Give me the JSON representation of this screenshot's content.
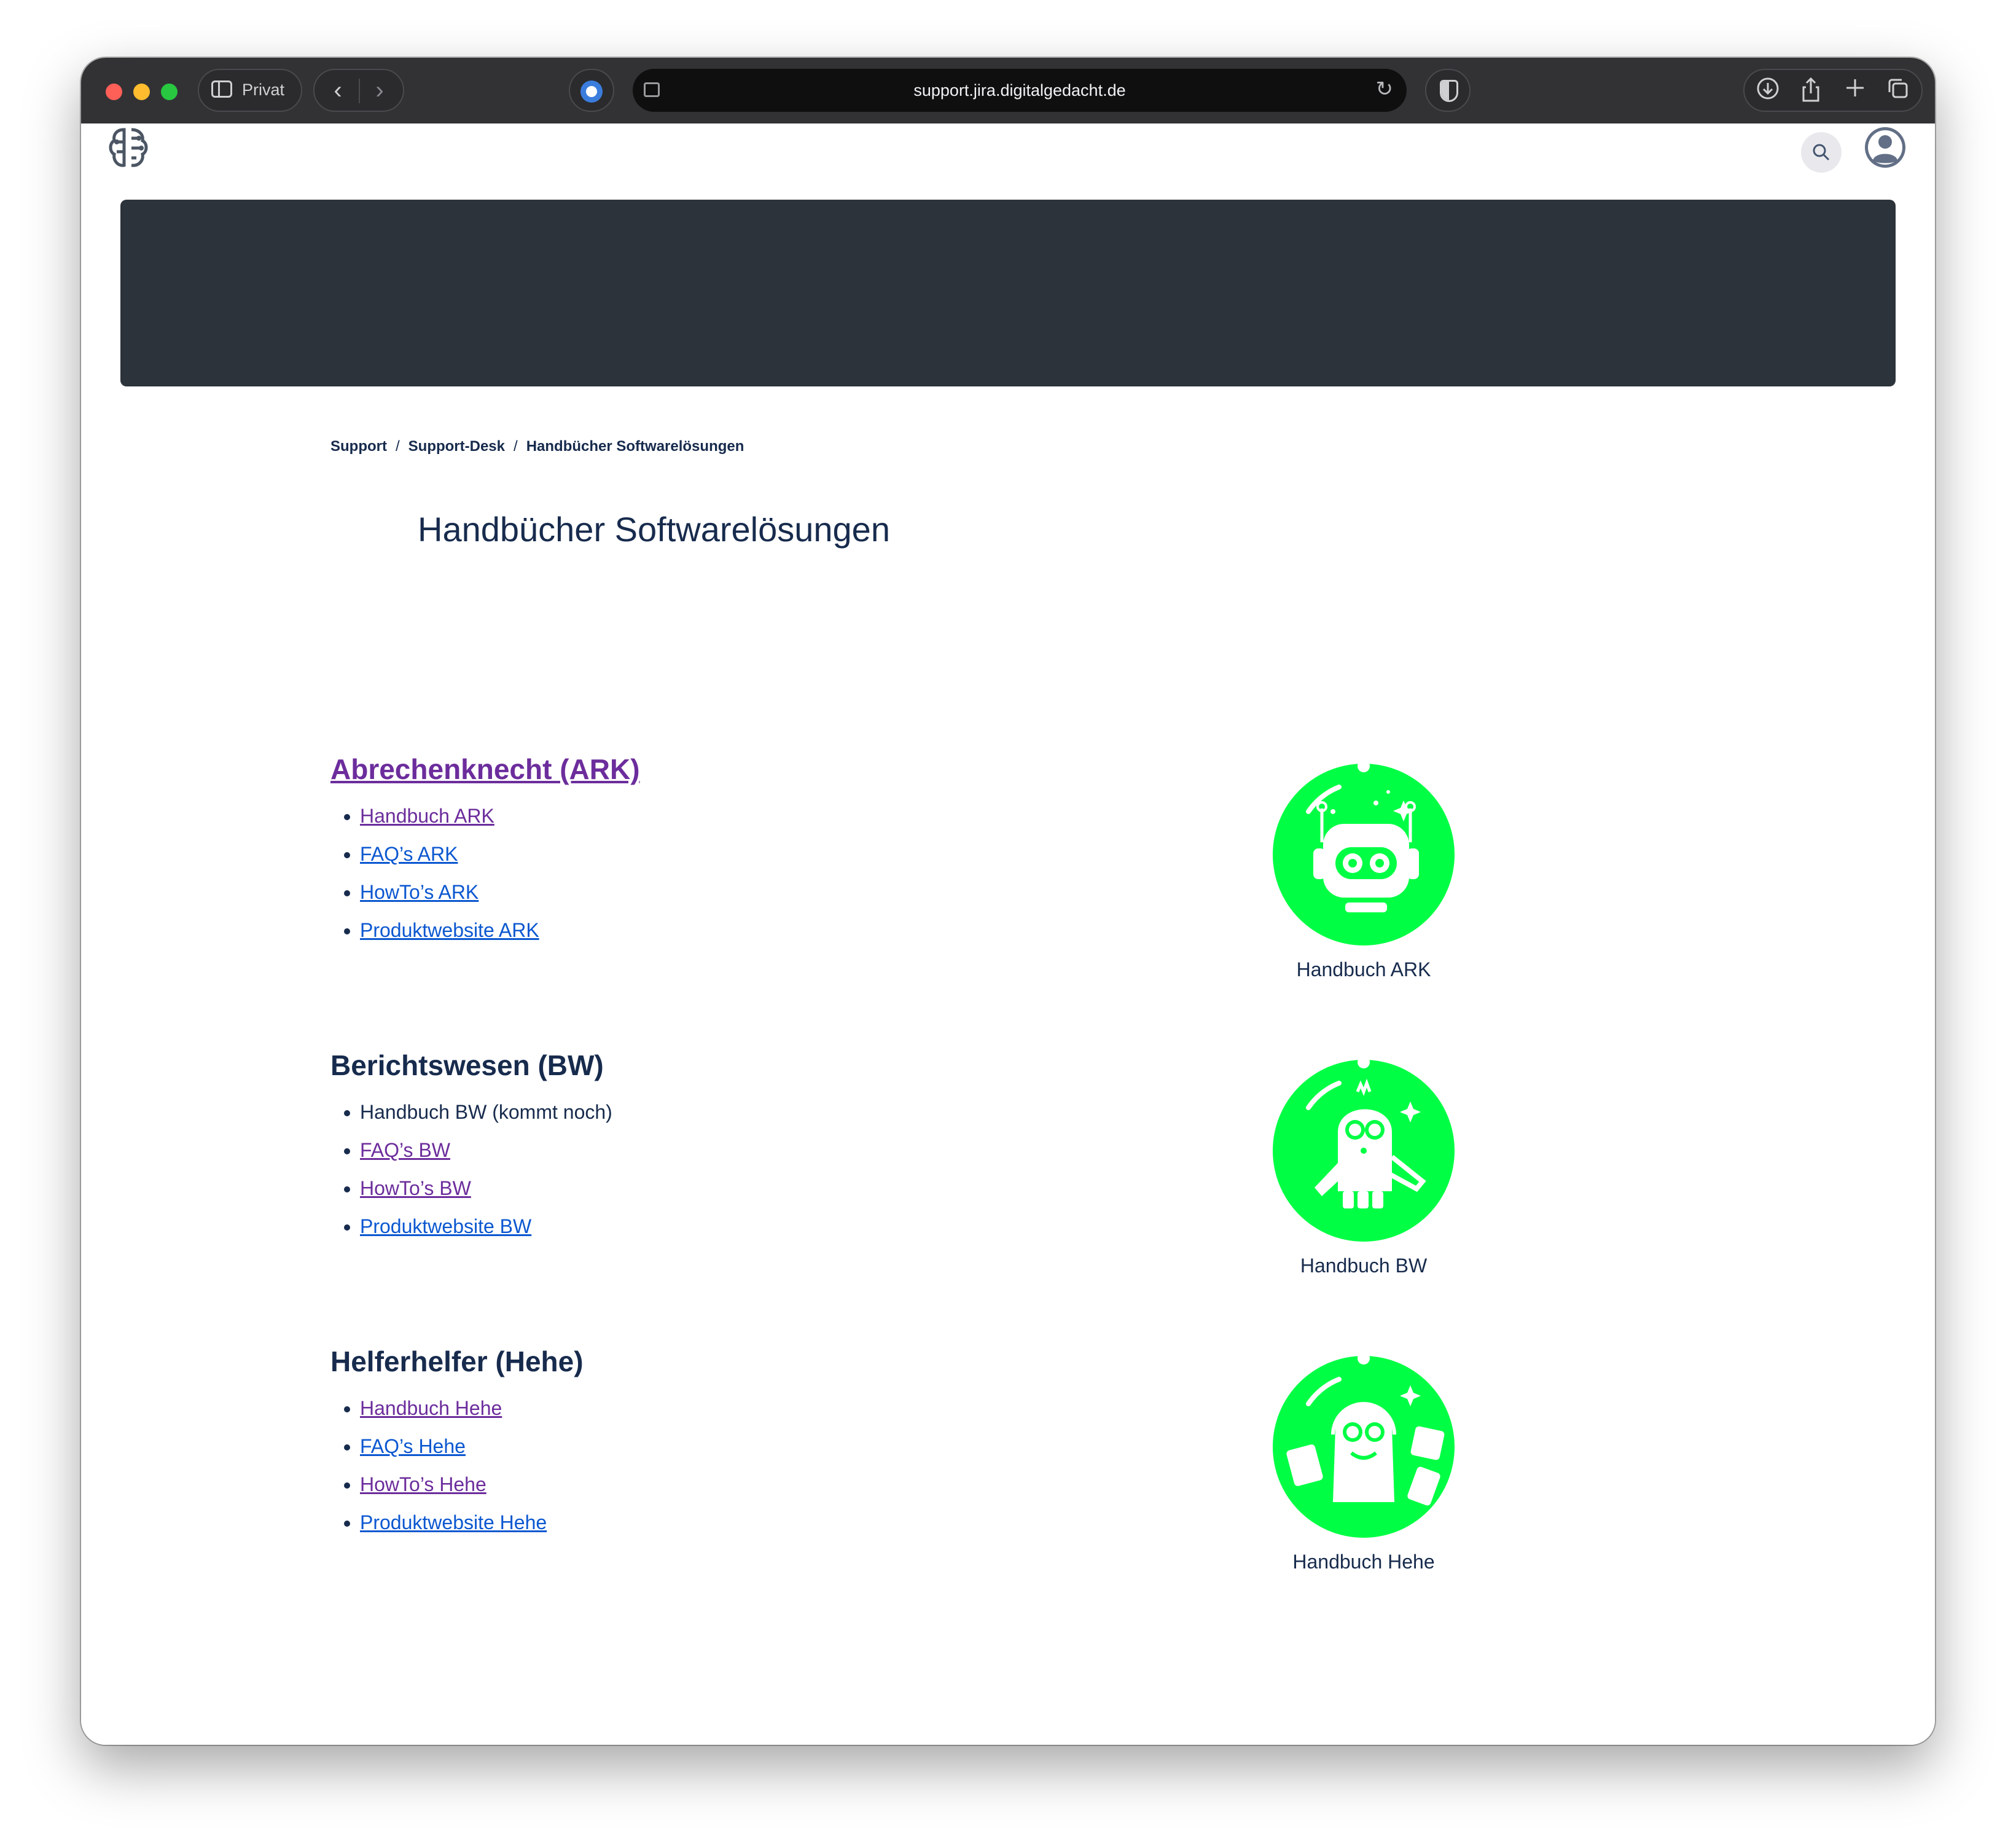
{
  "browser": {
    "window_label": "Privat",
    "url": "support.jira.digitalgedacht.de"
  },
  "breadcrumb": [
    "Support",
    "Support-Desk",
    "Handbücher Softwarelösungen"
  ],
  "page_title": "Handbücher Softwarelösungen",
  "sections": [
    {
      "title": "Abrechenknecht (ARK)",
      "title_is_link": true,
      "items": [
        "Handbuch ARK",
        "FAQ’s ARK",
        "HowTo’s ARK",
        "Produktwebsite ARK"
      ],
      "mascot_caption": "Handbuch ARK"
    },
    {
      "title": "Berichtswesen (BW)",
      "title_is_link": false,
      "items": [
        "Handbuch BW (kommt noch)",
        "FAQ’s BW",
        "HowTo’s BW",
        "Produktwebsite BW"
      ],
      "mascot_caption": "Handbuch BW"
    },
    {
      "title": "Helferhelfer (Hehe)",
      "title_is_link": false,
      "items": [
        "Handbuch Hehe",
        "FAQ’s Hehe",
        "HowTo’s Hehe",
        "Produktwebsite Hehe"
      ],
      "mascot_caption": "Handbuch Hehe"
    }
  ],
  "icons": {
    "toolbar": [
      "sidebar-icon",
      "back-icon",
      "forward-icon",
      "extension-icon",
      "page-icon",
      "reload-icon",
      "shield-icon",
      "download-icon",
      "share-icon",
      "new-tab-icon",
      "tabs-overview-icon"
    ],
    "site": [
      "brain-circuit-logo-icon",
      "search-icon",
      "user-avatar-icon"
    ]
  },
  "colors": {
    "mascot_green": "#00ff44",
    "banner": "#2d333b",
    "visited_link": "#6c2d9c",
    "link": "#0b57d0"
  }
}
